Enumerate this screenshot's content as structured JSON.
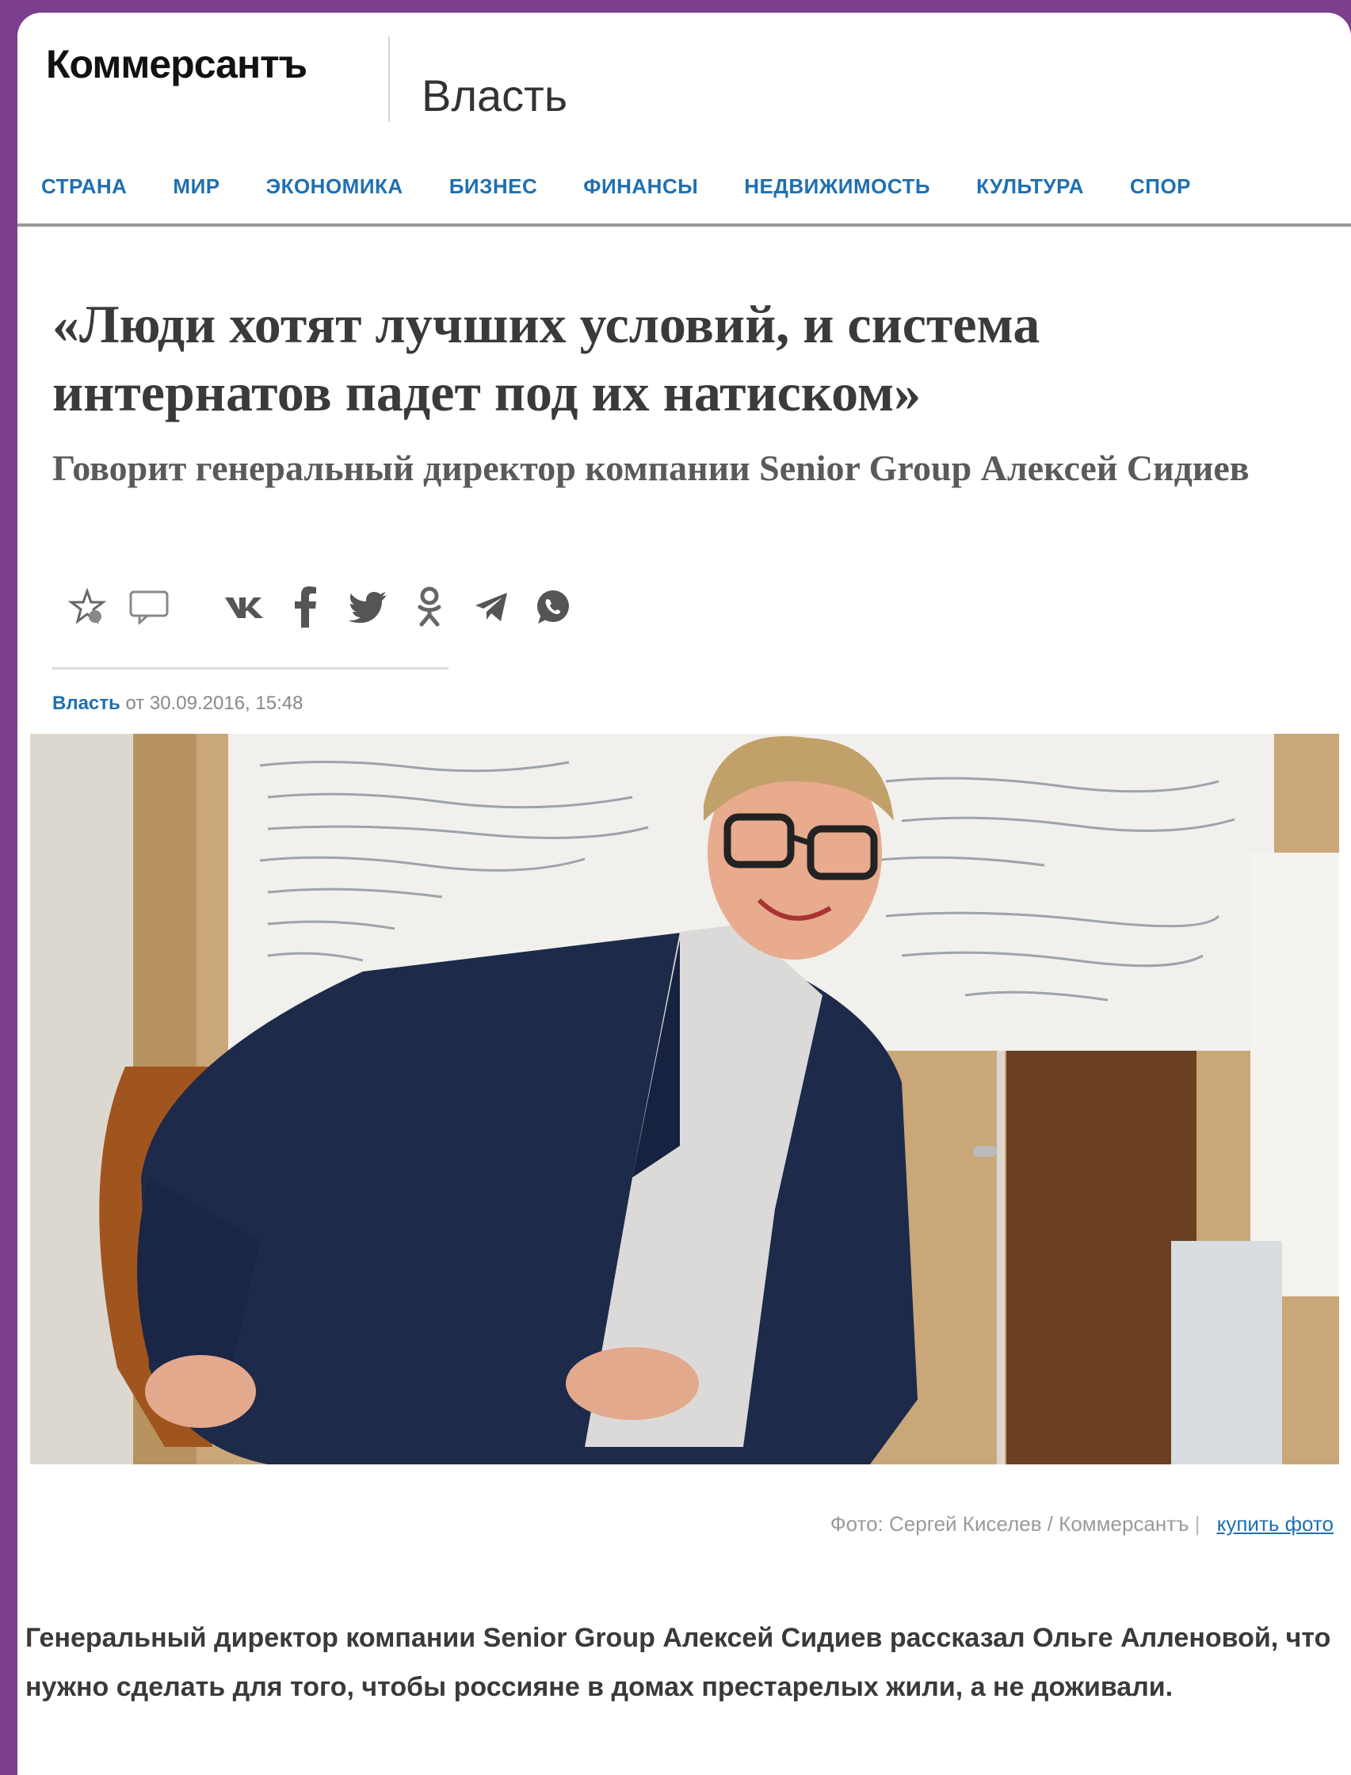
{
  "header": {
    "brand": "Коммерсантъ",
    "section": "Власть"
  },
  "nav": [
    "СТРАНА",
    "МИР",
    "ЭКОНОМИКА",
    "БИЗНЕС",
    "ФИНАНСЫ",
    "НЕДВИЖИМОСТЬ",
    "КУЛЬТУРА",
    "СПОР"
  ],
  "article": {
    "headline": "«Люди хотят лучших условий, и система интернатов падет под их натиском»",
    "subtitle": "Говорит генеральный директор компании Senior Group Алексей Сидиев",
    "source": "Власть",
    "date_text": "от 30.09.2016, 15:48",
    "photo_credit": "Фото: Сергей Киселев / Коммерсантъ",
    "buy_photo": "купить фото",
    "lead": "Генеральный директор компании Senior Group Алексей Сидиев рассказал Ольге Алленовой, что нужно сделать для того, чтобы россияне в домах престарелых жили, а не доживали."
  },
  "share_icons": [
    "favorite-icon",
    "comment-icon",
    "vk-icon",
    "facebook-icon",
    "twitter-icon",
    "odnoklassniki-icon",
    "telegram-icon",
    "whatsapp-icon"
  ],
  "colors": {
    "background": "#7b3f8e",
    "link": "#1f6fb2",
    "text": "#3a3a3a"
  }
}
